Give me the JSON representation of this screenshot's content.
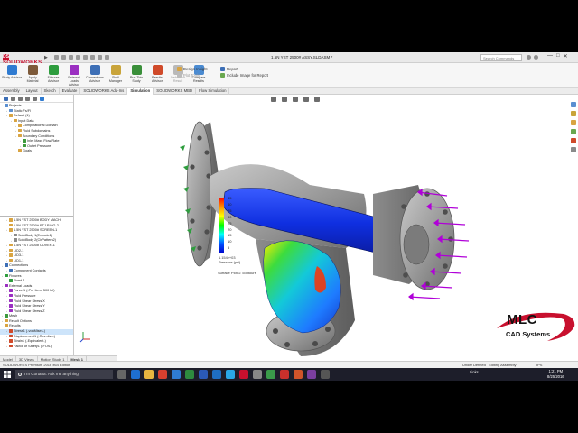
{
  "window": {
    "app_name": "SOLIDWORKS",
    "document_title": "1.5N YST 2500# ASSY.SLDASM *",
    "search_placeholder": "Search Commands",
    "controls": [
      "—",
      "□",
      "✕"
    ]
  },
  "ribbon": {
    "buttons": [
      {
        "label": "Study Advisor",
        "icon": "study-advisor-icon",
        "color": "#2f7bd1"
      },
      {
        "label": "Apply Material",
        "icon": "apply-material-icon",
        "color": "#7d5a3a"
      },
      {
        "label": "Fixtures Advisor",
        "icon": "fixtures-advisor-icon",
        "color": "#2e9d3e"
      },
      {
        "label": "External Loads Advisor",
        "icon": "external-loads-icon",
        "color": "#9b2fc1"
      },
      {
        "label": "Connections Advisor",
        "icon": "connections-advisor-icon",
        "color": "#3d6fb6"
      },
      {
        "label": "Shell Manager",
        "icon": "shell-manager-icon",
        "color": "#c9a43a"
      },
      {
        "label": "Run This Study",
        "icon": "run-study-icon",
        "color": "#3a8f3a"
      },
      {
        "label": "Results Advisor",
        "icon": "results-advisor-icon",
        "color": "#d04a2a"
      },
      {
        "label": "Deformed Result",
        "icon": "deformed-result-icon",
        "color": "#b9b9b9"
      },
      {
        "label": "Compare Results",
        "icon": "compare-results-icon",
        "color": "#4b8bd1"
      }
    ],
    "design_insight": "Design Insight",
    "plot_tools": "Plot Tools",
    "report": "Report",
    "include_image": "Include Image for Report"
  },
  "tabs": [
    "Assembly",
    "Layout",
    "Sketch",
    "Evaluate",
    "SOLIDWORKS Add-Ins",
    "Simulation",
    "SOLIDWORKS MBD",
    "Flow Simulation"
  ],
  "active_tab": "Simulation",
  "tree": {
    "top": [
      {
        "label": "Projects",
        "indent": 0,
        "color": "#5a8fd1"
      },
      {
        "label": "Static Fs/Fl",
        "indent": 1,
        "color": "#5a8fd1"
      },
      {
        "label": "Default (1)",
        "indent": 1,
        "color": "#d9a441"
      },
      {
        "label": "Input Data",
        "indent": 2,
        "color": "#d9a441"
      },
      {
        "label": "Computational Domain",
        "indent": 3,
        "color": "#d9a441"
      },
      {
        "label": "Fluid Subdomains",
        "indent": 3,
        "color": "#d9a441"
      },
      {
        "label": "Boundary Conditions",
        "indent": 3,
        "color": "#d9a441"
      },
      {
        "label": "Inlet Mass Flow Rate",
        "indent": 4,
        "color": "#3d9a3d"
      },
      {
        "label": "Outlet Pressure",
        "indent": 4,
        "color": "#3d9a3d"
      },
      {
        "label": "Goals",
        "indent": 3,
        "color": "#d9a441"
      }
    ],
    "bottom": [
      {
        "label": "1.5N YST 2500# BODY MACHI",
        "indent": 1,
        "color": "#d9a441"
      },
      {
        "label": "1.5N YST 2500# RTJ RING-2",
        "indent": 1,
        "color": "#d9a441"
      },
      {
        "label": "1.5N YST 2500# SCREEN-1",
        "indent": 1,
        "color": "#d9a441"
      },
      {
        "label": "SolidBody 1(Extrude1)",
        "indent": 2,
        "color": "#8a8a8a"
      },
      {
        "label": "SolidBody 2(CirPattern2)",
        "indent": 2,
        "color": "#8a8a8a"
      },
      {
        "label": "1.5N YST 2500# COVER-1",
        "indent": 1,
        "color": "#d9a441"
      },
      {
        "label": "LID2-1",
        "indent": 1,
        "color": "#d9a441"
      },
      {
        "label": "LID3-1",
        "indent": 1,
        "color": "#d9a441"
      },
      {
        "label": "LID1-1",
        "indent": 1,
        "color": "#d9a441"
      },
      {
        "label": "Connections",
        "indent": 0,
        "color": "#3d6fb6"
      },
      {
        "label": "Component Contacts",
        "indent": 1,
        "color": "#3d6fb6"
      },
      {
        "label": "Fixtures",
        "indent": 0,
        "color": "#2e9d3e"
      },
      {
        "label": "Fixed-1",
        "indent": 1,
        "color": "#2e9d3e"
      },
      {
        "label": "External Loads",
        "indent": 0,
        "color": "#9b2fc1"
      },
      {
        "label": "Force-1 (-Per item: 500 lbf)",
        "indent": 1,
        "color": "#9b2fc1"
      },
      {
        "label": "Fluid Pressure",
        "indent": 1,
        "color": "#9b2fc1"
      },
      {
        "label": "Fluid Shear Stress X",
        "indent": 1,
        "color": "#9b2fc1"
      },
      {
        "label": "Fluid Shear Stress Y",
        "indent": 1,
        "color": "#9b2fc1"
      },
      {
        "label": "Fluid Shear Stress Z",
        "indent": 1,
        "color": "#9b2fc1"
      },
      {
        "label": "Mesh",
        "indent": 0,
        "color": "#3d9a3d"
      },
      {
        "label": "Result Options",
        "indent": 0,
        "color": "#d9a441"
      },
      {
        "label": "Results",
        "indent": 0,
        "color": "#d9a441"
      },
      {
        "label": "Stress1 (-vonMises-)",
        "indent": 1,
        "color": "#d04a2a",
        "selected": true
      },
      {
        "label": "Displacement1 (-Res disp-)",
        "indent": 1,
        "color": "#d04a2a"
      },
      {
        "label": "Strain1 (-Equivalent-)",
        "indent": 1,
        "color": "#d04a2a"
      },
      {
        "label": "Factor of Safety1 (-FOS-)",
        "indent": 1,
        "color": "#d04a2a"
      }
    ]
  },
  "legend": {
    "ticks": [
      "45",
      "40",
      "35",
      "30",
      "25",
      "20",
      "15",
      "10",
      "5"
    ],
    "max_label": "1.154e+03",
    "units": "Pressure (psi)",
    "colors": [
      "#ff0000",
      "#ff8c00",
      "#ffff00",
      "#00ff00",
      "#00ffff",
      "#0050ff",
      "#0000c8"
    ]
  },
  "plot_title": "Surface Plot 1: contours",
  "bottom_tabs": [
    "Model",
    "3D Views",
    "Motion Study 1",
    "Mesh 1"
  ],
  "status": {
    "left": "SOLIDWORKS Premium 2016 x64 Edition",
    "mid": "Under Defined",
    "right": "Editing Assembly",
    "units": "IPS"
  },
  "taskbar": {
    "search_text": "I'm Cortana. Ask me anything.",
    "links": "Links",
    "time": "1:21 PM",
    "date": "8/25/2016"
  },
  "watermark": {
    "line1": "MLC",
    "line2": "CAD Systems"
  }
}
